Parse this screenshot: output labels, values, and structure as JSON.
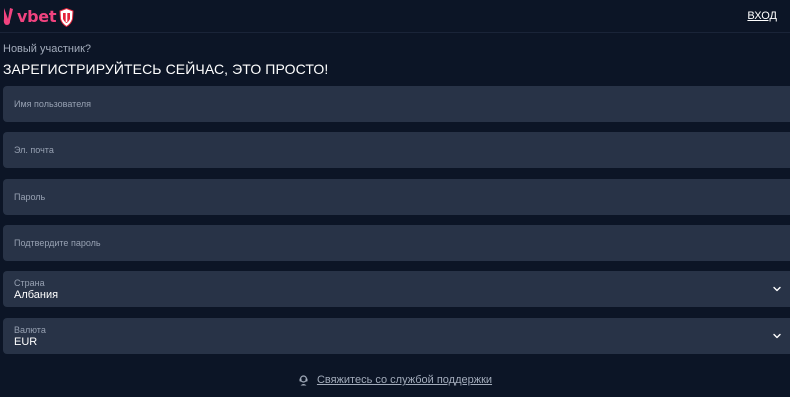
{
  "header": {
    "logo_text": "vbet",
    "login_label": "ВХОД"
  },
  "form": {
    "subtitle": "Новый участник?",
    "title": "ЗАРЕГИСТРИРУЙТЕСЬ СЕЙЧАС, ЭТО ПРОСТО!",
    "username_placeholder": "Имя пользователя",
    "email_placeholder": "Эл. почта",
    "password_placeholder": "Пароль",
    "confirm_password_placeholder": "Подтвердите пароль",
    "country": {
      "label": "Страна",
      "value": "Албания"
    },
    "currency": {
      "label": "Валюта",
      "value": "EUR"
    }
  },
  "footer": {
    "support_label": "Свяжитесь со службой поддержки"
  },
  "colors": {
    "background": "#0c1526",
    "field": "#283347",
    "brand_pink": "#f1437f"
  },
  "icons": [
    "vbet-logo-icon",
    "shield-emblem-icon",
    "chevron-down-icon",
    "support-headset-icon"
  ]
}
